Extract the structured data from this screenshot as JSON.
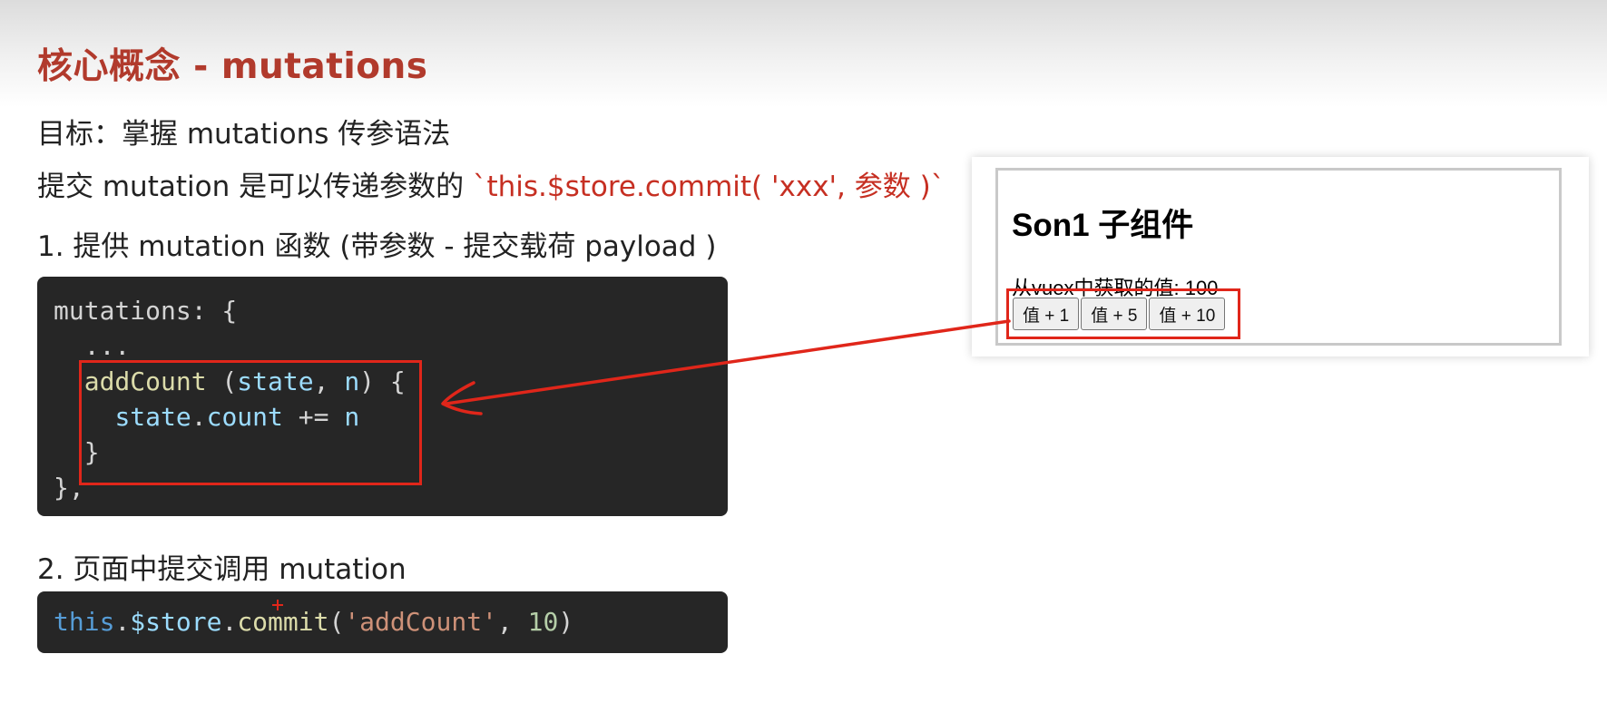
{
  "slide": {
    "title": "核心概念 - mutations",
    "goal": "目标：掌握 mutations 传参语法",
    "commit_text": "提交 mutation 是可以传递参数的 ",
    "commit_code": "`this.$store.commit( 'xxx',  参数 )`",
    "step1": "1. 提供 mutation 函数 (带参数 - 提交载荷 payload )",
    "step2": "2. 页面中提交调用 mutation"
  },
  "code1": {
    "line1": "mutations: {",
    "line2": "  ...",
    "fn_name": "addCount",
    "open_paren": " (",
    "param_state": "state",
    "comma": ", ",
    "param_n": "n",
    "close": ") {",
    "body_state": "state",
    "body_dot": ".",
    "body_count": "count",
    "body_op": " += ",
    "body_n": "n",
    "close_fn": "  }",
    "close_obj": "},"
  },
  "code2": {
    "this_kw": "this",
    "dot1": ".",
    "store": "$store",
    "dot2": ".",
    "commit": "commit",
    "open": "(",
    "arg_str": "'addCount'",
    "comma": ", ",
    "arg_num": "10",
    "close": ")"
  },
  "preview": {
    "component_title": "Son1 子组件",
    "value_label": "从vuex中获取的值: ",
    "value": "100",
    "buttons": [
      "值 + 1",
      "值 + 5",
      "值 + 10"
    ]
  },
  "colors": {
    "title": "#b13a2c",
    "highlight": "#e0261a",
    "code_bg": "#262626"
  }
}
